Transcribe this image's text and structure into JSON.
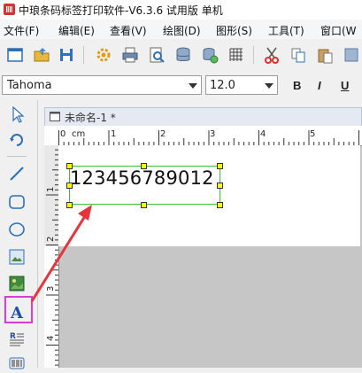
{
  "window": {
    "title": "中琅条码标签打印软件-V6.3.6 试用版 单机"
  },
  "menu": [
    {
      "label": "文件(F)"
    },
    {
      "label": "编辑(E)"
    },
    {
      "label": "查看(V)"
    },
    {
      "label": "绘图(D)"
    },
    {
      "label": "图形(S)"
    },
    {
      "label": "工具(T)"
    },
    {
      "label": "窗口(W"
    }
  ],
  "toolbar": {
    "icons": [
      "new-document-icon",
      "open-folder-icon",
      "save-icon",
      "settings-gear-icon",
      "print-icon",
      "print-preview-icon",
      "database-icon",
      "database-settings-icon",
      "grid-icon",
      "cut-icon",
      "copy-icon",
      "paste-icon"
    ]
  },
  "fontbar": {
    "font_name": "Tahoma",
    "font_size": "12.0",
    "bold_label": "B",
    "italic_label": "I",
    "underline_label": "U"
  },
  "palette": {
    "tools": [
      "select-arrow-icon",
      "rotate-icon",
      "line-tool-icon",
      "rounded-rect-tool-icon",
      "ellipse-tool-icon",
      "image-tool-icon",
      "picture-tool-icon",
      "text-tool-icon",
      "rich-text-tool-icon",
      "barcode-tool-icon"
    ],
    "text_tool_glyph": "A",
    "highlight_color": "#d83fd8"
  },
  "document": {
    "tab_title": "未命名-1 *",
    "ruler_unit": "cm",
    "ruler_h_labels": [
      "0",
      "1",
      "2",
      "3",
      "4",
      "5"
    ],
    "ruler_v_labels": [
      "1",
      "2",
      "3",
      "4"
    ],
    "selected_text": "123456789012"
  },
  "annotation": {
    "arrow_color": "#e8333a"
  }
}
